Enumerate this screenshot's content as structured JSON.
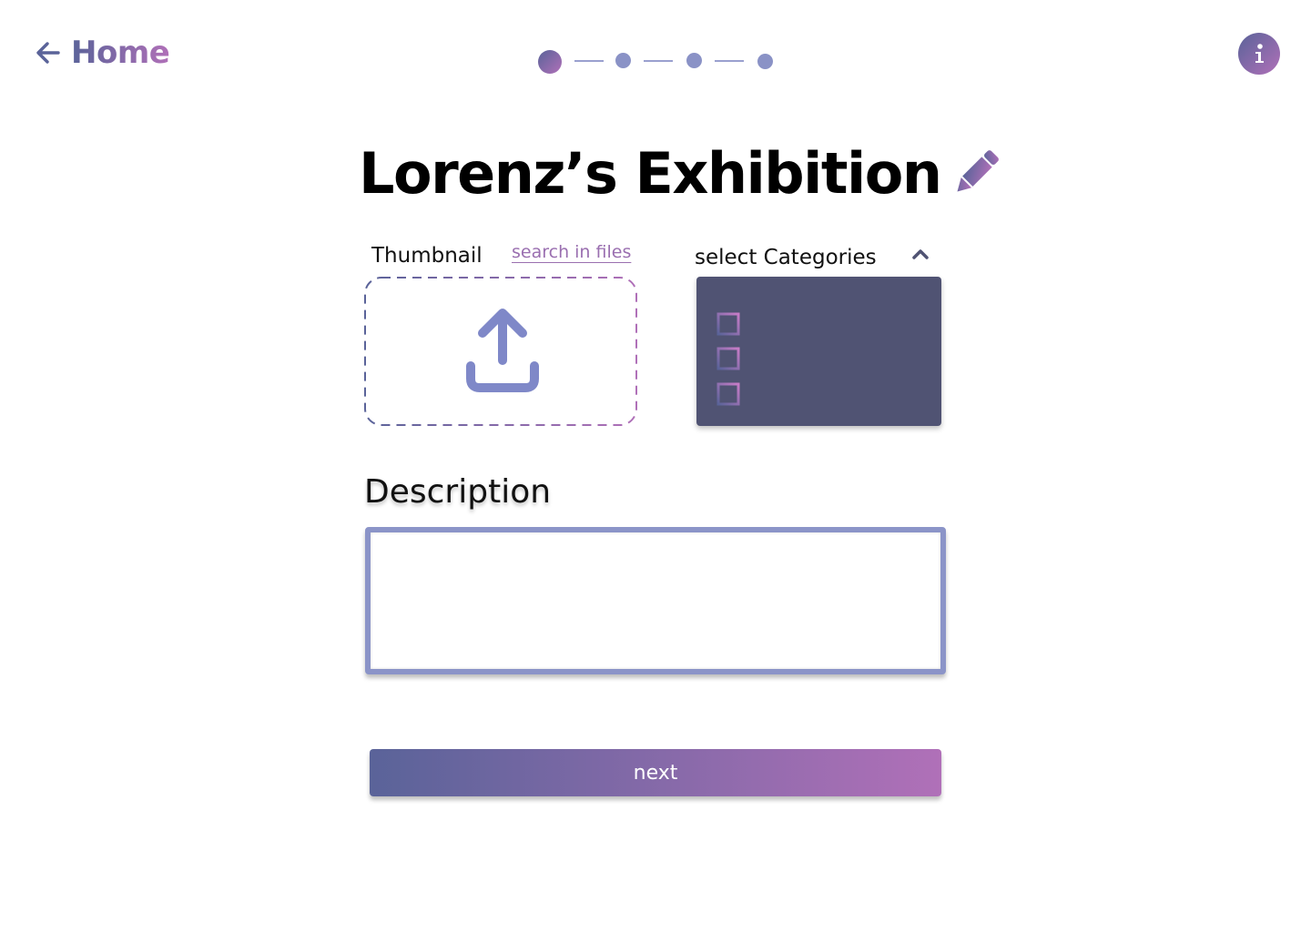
{
  "header": {
    "home_label": "Home",
    "back_icon": "arrow-left-icon",
    "info_icon": "info-icon"
  },
  "stepper": {
    "total_steps": 4,
    "current_step": 1
  },
  "title": {
    "text": "Lorenz’s Exhibition",
    "edit_icon": "pencil-icon"
  },
  "thumbnail": {
    "label": "Thumbnail",
    "search_link": "search in files",
    "upload_icon": "upload-icon"
  },
  "categories": {
    "label": "select Categories",
    "toggle_icon": "chevron-up-icon",
    "options": [
      {
        "label": "",
        "checked": false
      },
      {
        "label": "",
        "checked": false
      },
      {
        "label": "",
        "checked": false
      }
    ]
  },
  "description": {
    "label": "Description",
    "value": ""
  },
  "actions": {
    "next_label": "next"
  },
  "colors": {
    "gradient_start": "#5a6399",
    "gradient_end": "#b070b8",
    "panel_bg": "#505373",
    "input_border": "#8b94c8",
    "upload_icon": "#7f88c8",
    "stepper_dot": "#8a92c6"
  }
}
